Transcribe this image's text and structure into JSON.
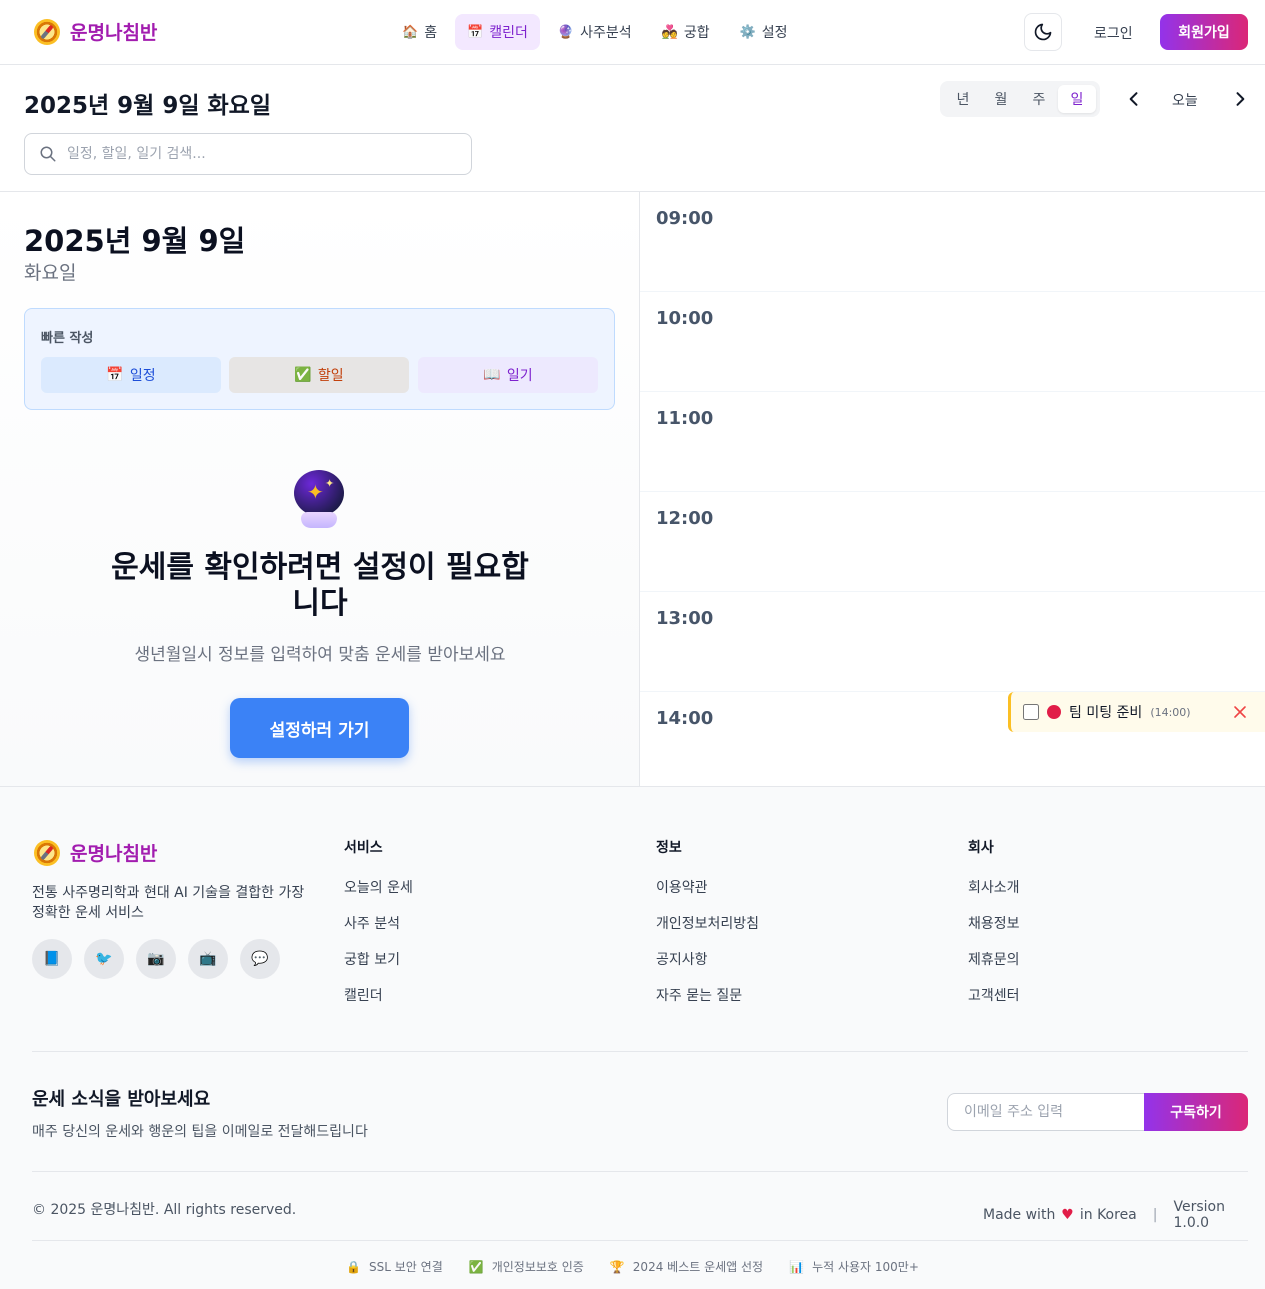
{
  "header": {
    "brand": "운명나침반",
    "nav": [
      {
        "icon": "🏠",
        "label": "홈"
      },
      {
        "icon": "📅",
        "label": "캘린더"
      },
      {
        "icon": "🔮",
        "label": "사주분석"
      },
      {
        "icon": "💑",
        "label": "궁합"
      },
      {
        "icon": "⚙️",
        "label": "설정"
      }
    ],
    "login": "로그인",
    "signup": "회원가입"
  },
  "toolbar": {
    "date_title": "2025년 9월 9일 화요일",
    "views": [
      "년",
      "월",
      "주",
      "일"
    ],
    "active_view": "일",
    "today": "오늘",
    "search_placeholder": "일정, 할일, 일기 검색..."
  },
  "day_panel": {
    "date": "2025년 9월 9일",
    "weekday": "화요일",
    "quick_title": "빠른 작성",
    "quick": [
      {
        "icon": "📅",
        "label": "일정"
      },
      {
        "icon": "✅",
        "label": "할일"
      },
      {
        "icon": "📖",
        "label": "일기"
      }
    ],
    "empty_title": "운세를 확인하려면 설정이 필요합니다",
    "empty_sub": "생년월일시 정보를 입력하여 맞춤 운세를 받아보세요",
    "button": "설정하러 가기"
  },
  "timeline": {
    "hours": [
      "09:00",
      "10:00",
      "11:00",
      "12:00",
      "13:00",
      "14:00"
    ],
    "events": [
      {
        "title": "팀 미팅 준비",
        "time": "(14:00)",
        "color": "#e11d48",
        "done": false
      }
    ]
  },
  "footer": {
    "brand": "운명나침반",
    "desc": "전통 사주명리학과 현대 AI 기술을 결합한 가장 정확한 운세 서비스",
    "socials": [
      "📘",
      "🐦",
      "📷",
      "📺",
      "💬"
    ],
    "columns": [
      {
        "title": "서비스",
        "links": [
          "오늘의 운세",
          "사주 분석",
          "궁합 보기",
          "캘린더"
        ]
      },
      {
        "title": "정보",
        "links": [
          "이용약관",
          "개인정보처리방침",
          "공지사항",
          "자주 묻는 질문"
        ]
      },
      {
        "title": "회사",
        "links": [
          "회사소개",
          "채용정보",
          "제휴문의",
          "고객센터"
        ]
      }
    ],
    "newsletter": {
      "title": "운세 소식을 받아보세요",
      "sub": "매주 당신의 운세와 행운의 팁을 이메일로 전달해드립니다",
      "placeholder": "이메일 주소 입력",
      "button": "구독하기"
    },
    "copyright": "© 2025 운명나침반. All rights reserved.",
    "made_with": "Made with",
    "in_korea": "in Korea",
    "version": "Version 1.0.0",
    "badges": [
      {
        "icon": "🔒",
        "label": "SSL 보안 연결"
      },
      {
        "icon": "✅",
        "label": "개인정보보호 인증"
      },
      {
        "icon": "🏆",
        "label": "2024 베스트 운세앱 선정"
      },
      {
        "icon": "📊",
        "label": "누적 사용자 100만+"
      }
    ]
  }
}
